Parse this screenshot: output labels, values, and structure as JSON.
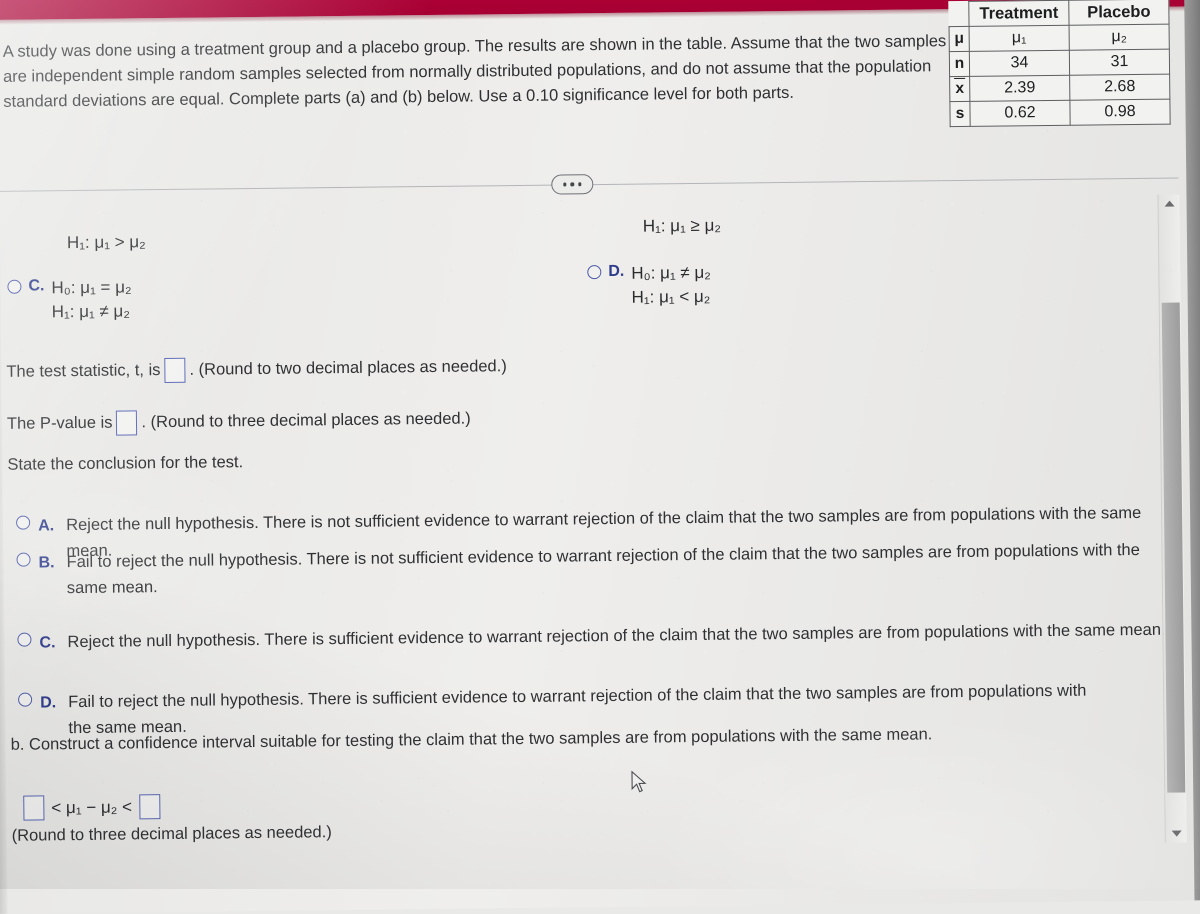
{
  "colors": {
    "top_band": "#a70033",
    "radio_blue": "#4a58a8",
    "option_letter": "#2f3c8c",
    "answer_box_border": "#5a68b5",
    "body_text": "#2f3033"
  },
  "statement": {
    "text": "A study was done using a treatment group and a placebo group. The results are shown in the table. Assume that the two samples are independent simple random samples selected from normally distributed populations, and do not assume that the population standard deviations are equal. Complete parts (a) and (b) below. Use a 0.10 significance level for both parts."
  },
  "data_table": {
    "corner_label": "",
    "columns": [
      "Treatment",
      "Placebo"
    ],
    "rows": [
      {
        "label": "μ",
        "label_kind": "mu",
        "values": [
          "μ₁",
          "μ₂"
        ]
      },
      {
        "label": "n",
        "label_kind": "n",
        "values": [
          "34",
          "31"
        ]
      },
      {
        "label": "x",
        "label_kind": "xbar",
        "values": [
          "2.39",
          "2.68"
        ]
      },
      {
        "label": "s",
        "label_kind": "s",
        "values": [
          "0.62",
          "0.98"
        ]
      }
    ]
  },
  "divider": {
    "ellipsis_label": "..."
  },
  "hypotheses": {
    "top_left_h1": "H₁: μ₁ > μ₂",
    "top_right_h1": "H₁: μ₁ ≥ μ₂",
    "option_c": {
      "letter": "C.",
      "h0": "H₀: μ₁ = μ₂",
      "h1": "H₁: μ₁ ≠ μ₂",
      "selected": false
    },
    "option_d": {
      "letter": "D.",
      "h0": "H₀: μ₁ ≠ μ₂",
      "h1": "H₁: μ₁ < μ₂",
      "selected": false
    }
  },
  "test_statistic": {
    "label_before": "The test statistic, t, is",
    "value": "",
    "label_after": ". (Round to two decimal places as needed.)"
  },
  "p_value": {
    "label_before": "The P-value is",
    "value": "",
    "label_after": ". (Round to three decimal places as needed.)"
  },
  "conclusion_prompt": "State the conclusion for the test.",
  "conclusion_choices": [
    {
      "letter": "A.",
      "text": "Reject the null hypothesis. There is not sufficient evidence to warrant rejection of the claim that the two samples are from populations with the same mean.",
      "selected": false
    },
    {
      "letter": "B.",
      "text": "Fail to reject the null hypothesis. There is not sufficient evidence to warrant rejection of the claim that the two samples are from populations with the same mean.",
      "selected": false
    },
    {
      "letter": "C.",
      "text": "Reject the null hypothesis. There is sufficient evidence to warrant rejection of the claim that the two samples are from populations with the same mean.",
      "selected": false
    },
    {
      "letter": "D.",
      "text": "Fail to reject the null hypothesis. There is sufficient evidence to warrant rejection of the claim that the two samples are from populations with the same mean.",
      "selected": false
    }
  ],
  "part_b": {
    "prompt": "b. Construct a confidence interval suitable for testing the claim that the two samples are from populations with the same mean.",
    "lower_value": "",
    "middle_expression": "< μ₁ − μ₂ <",
    "upper_value": "",
    "note": "(Round to three decimal places as needed.)"
  },
  "scrollbar": {
    "up_arrow": "▲",
    "down_arrow": "▼"
  }
}
